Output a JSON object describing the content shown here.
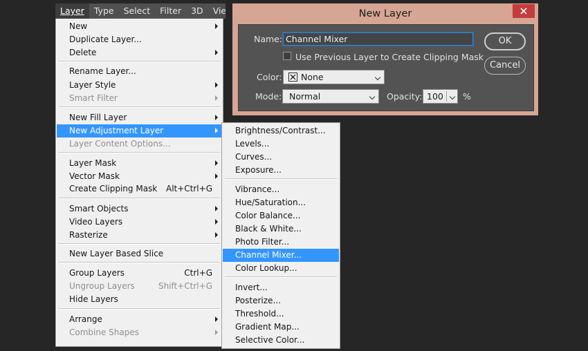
{
  "menubar": {
    "items": [
      {
        "label": "Layer",
        "active": true
      },
      {
        "label": "Type",
        "active": false
      },
      {
        "label": "Select",
        "active": false
      },
      {
        "label": "Filter",
        "active": false
      },
      {
        "label": "3D",
        "active": false
      },
      {
        "label": "View",
        "active": false
      }
    ]
  },
  "layer_menu": {
    "items": [
      {
        "label": "New",
        "submenu": true
      },
      {
        "label": "Duplicate Layer..."
      },
      {
        "label": "Delete",
        "submenu": true
      },
      {
        "label": "Rename Layer..."
      },
      {
        "label": "Layer Style",
        "submenu": true
      },
      {
        "label": "Smart Filter",
        "submenu": true,
        "disabled": true
      },
      {
        "label": "New Fill Layer",
        "submenu": true
      },
      {
        "label": "New Adjustment Layer",
        "submenu": true,
        "highlighted": true
      },
      {
        "label": "Layer Content Options...",
        "disabled": true
      },
      {
        "label": "Layer Mask",
        "submenu": true
      },
      {
        "label": "Vector Mask",
        "submenu": true
      },
      {
        "label": "Create Clipping Mask",
        "shortcut": "Alt+Ctrl+G"
      },
      {
        "label": "Smart Objects",
        "submenu": true
      },
      {
        "label": "Video Layers",
        "submenu": true
      },
      {
        "label": "Rasterize",
        "submenu": true
      },
      {
        "label": "New Layer Based Slice"
      },
      {
        "label": "Group Layers",
        "shortcut": "Ctrl+G"
      },
      {
        "label": "Ungroup Layers",
        "shortcut": "Shift+Ctrl+G",
        "disabled": true
      },
      {
        "label": "Hide Layers"
      },
      {
        "label": "Arrange",
        "submenu": true
      },
      {
        "label": "Combine Shapes",
        "submenu": true,
        "disabled": true
      }
    ]
  },
  "adjustment_submenu": {
    "items": [
      {
        "label": "Brightness/Contrast..."
      },
      {
        "label": "Levels..."
      },
      {
        "label": "Curves..."
      },
      {
        "label": "Exposure..."
      },
      {
        "label": "Vibrance..."
      },
      {
        "label": "Hue/Saturation..."
      },
      {
        "label": "Color Balance..."
      },
      {
        "label": "Black & White..."
      },
      {
        "label": "Photo Filter..."
      },
      {
        "label": "Channel Mixer...",
        "highlighted": true
      },
      {
        "label": "Color Lookup..."
      },
      {
        "label": "Invert..."
      },
      {
        "label": "Posterize..."
      },
      {
        "label": "Threshold..."
      },
      {
        "label": "Gradient Map..."
      },
      {
        "label": "Selective Color..."
      }
    ]
  },
  "dialog": {
    "title": "New Layer",
    "name_label": "Name:",
    "name_value": "Channel Mixer",
    "clipping_label": "Use Previous Layer to Create Clipping Mask",
    "clipping_checked": false,
    "color_label": "Color:",
    "color_value": "None",
    "mode_label": "Mode:",
    "mode_value": "Normal",
    "opacity_label": "Opacity:",
    "opacity_value": "100",
    "opacity_unit": "%",
    "ok_label": "OK",
    "cancel_label": "Cancel"
  },
  "colors": {
    "highlight": "#3396ff",
    "dialog_frame": "#d7a593",
    "close_button": "#c43c3c",
    "app_background": "#262626"
  }
}
